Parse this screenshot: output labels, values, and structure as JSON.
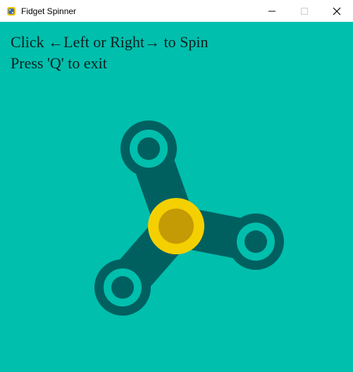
{
  "window": {
    "title": "Fidget Spinner",
    "controls": {
      "minimize_icon": "minimize-icon",
      "maximize_icon": "maximize-icon",
      "close_icon": "close-icon"
    },
    "app_icon": "python-icon"
  },
  "game": {
    "instructions": [
      "Click ←Left or Right→ to Spin",
      "Press 'Q' to exit"
    ],
    "colors": {
      "background": "#00bfad",
      "spinner_body": "#006060",
      "bearing_outer": "#f5d000",
      "bearing_inner": "#c49a05"
    }
  }
}
